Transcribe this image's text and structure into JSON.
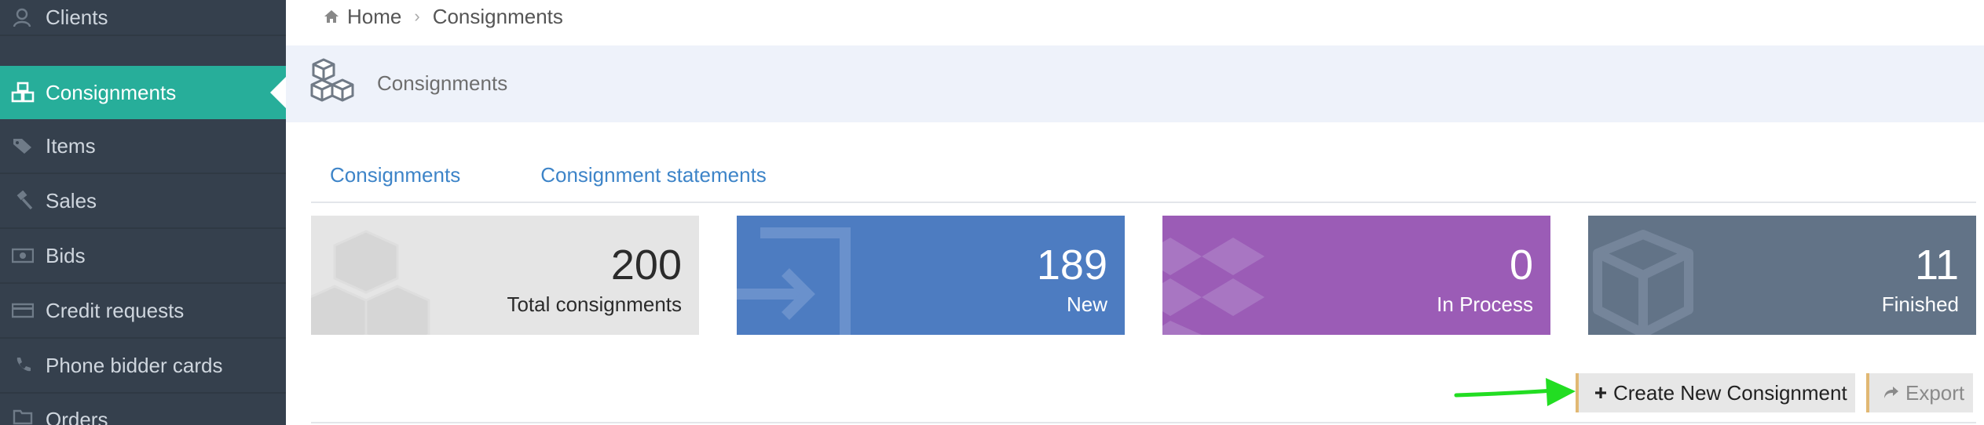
{
  "sidebar": {
    "items": [
      {
        "label": "Clients",
        "icon": "clients-icon",
        "active": false
      },
      {
        "label": "Consignments",
        "icon": "consignments-icon",
        "active": true
      },
      {
        "label": "Items",
        "icon": "tags-icon",
        "active": false
      },
      {
        "label": "Sales",
        "icon": "gavel-icon",
        "active": false
      },
      {
        "label": "Bids",
        "icon": "money-icon",
        "active": false
      },
      {
        "label": "Credit requests",
        "icon": "credit-card-icon",
        "active": false
      },
      {
        "label": "Phone bidder cards",
        "icon": "phone-icon",
        "active": false
      },
      {
        "label": "Orders",
        "icon": "folder-icon",
        "active": false
      }
    ]
  },
  "breadcrumb": {
    "home": "Home",
    "separator": "›",
    "current": "Consignments"
  },
  "page_header": {
    "title": "Consignments",
    "icon": "cubes-icon"
  },
  "tabs": [
    {
      "label": "Consignments"
    },
    {
      "label": "Consignment statements"
    }
  ],
  "stats": {
    "total": {
      "value": "200",
      "label": "Total consignments",
      "color": "#e5e5e5",
      "icon": "cubes-icon"
    },
    "new": {
      "value": "189",
      "label": "New",
      "color": "#4d7cc1",
      "icon": "sign-in-icon"
    },
    "in_process": {
      "value": "0",
      "label": "In Process",
      "color": "#9b5cb6",
      "icon": "dropbox-icon"
    },
    "finished": {
      "value": "11",
      "label": "Finished",
      "color": "#627387",
      "icon": "cube-icon"
    }
  },
  "actions": {
    "create_label": "Create New Consignment",
    "export_label": "Export"
  },
  "colors": {
    "sidebar_bg": "#35404d",
    "sidebar_active": "#27ae9a",
    "link_blue": "#3d84c8",
    "annotation_arrow": "#22dd22"
  }
}
